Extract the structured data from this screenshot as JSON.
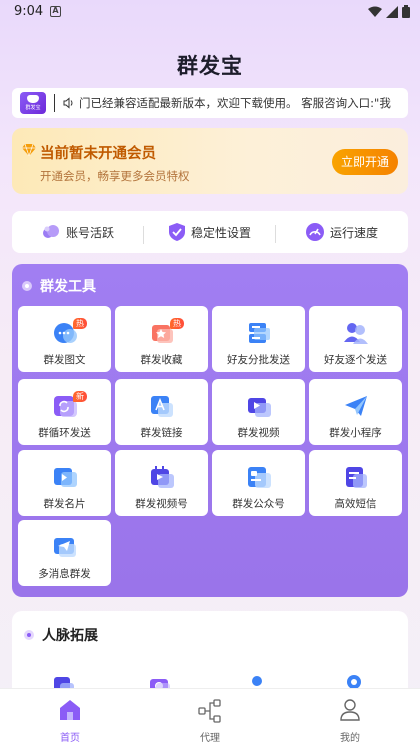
{
  "status_bar": {
    "time": "9:04",
    "notif": "A"
  },
  "app": {
    "title": "群发宝"
  },
  "notice": {
    "logo_text": "群发宝",
    "text": "门已经兼容适配最新版本，欢迎下载使用。 客服咨询入口:\"我"
  },
  "vip": {
    "title": "当前暂未开通会员",
    "subtitle": "开通会员，畅享更多会员特权",
    "button": "立即开通"
  },
  "status_row": [
    {
      "label": "账号活跃"
    },
    {
      "label": "稳定性设置"
    },
    {
      "label": "运行速度"
    }
  ],
  "tools": {
    "title": "群发工具",
    "items": [
      {
        "label": "群发图文",
        "badge": "热",
        "icon": "chat-bubbles-icon"
      },
      {
        "label": "群发收藏",
        "badge": "热",
        "icon": "star-folder-icon"
      },
      {
        "label": "好友分批发送",
        "badge": "",
        "icon": "batch-list-icon"
      },
      {
        "label": "好友逐个发送",
        "badge": "",
        "icon": "users-icon"
      },
      {
        "label": "群循环发送",
        "badge": "新",
        "icon": "loop-icon"
      },
      {
        "label": "群发链接",
        "badge": "",
        "icon": "link-icon"
      },
      {
        "label": "群发视频",
        "badge": "",
        "icon": "video-icon"
      },
      {
        "label": "群发小程序",
        "badge": "",
        "icon": "paper-plane-icon"
      },
      {
        "label": "群发名片",
        "badge": "",
        "icon": "card-icon"
      },
      {
        "label": "群发视频号",
        "badge": "",
        "icon": "channels-icon"
      },
      {
        "label": "群发公众号",
        "badge": "",
        "icon": "official-account-icon"
      },
      {
        "label": "高效短信",
        "badge": "",
        "icon": "sms-icon"
      },
      {
        "label": "多消息群发",
        "badge": "",
        "icon": "multi-message-icon"
      }
    ]
  },
  "network": {
    "title": "人脉拓展"
  },
  "tabbar": {
    "items": [
      {
        "label": "首页",
        "icon": "home-icon"
      },
      {
        "label": "代理",
        "icon": "share-nodes-icon"
      },
      {
        "label": "我的",
        "icon": "person-icon"
      }
    ]
  },
  "colors": {
    "accent": "#8b5cf6",
    "vip_orange": "#f58200",
    "panel": "#a17ef2"
  }
}
